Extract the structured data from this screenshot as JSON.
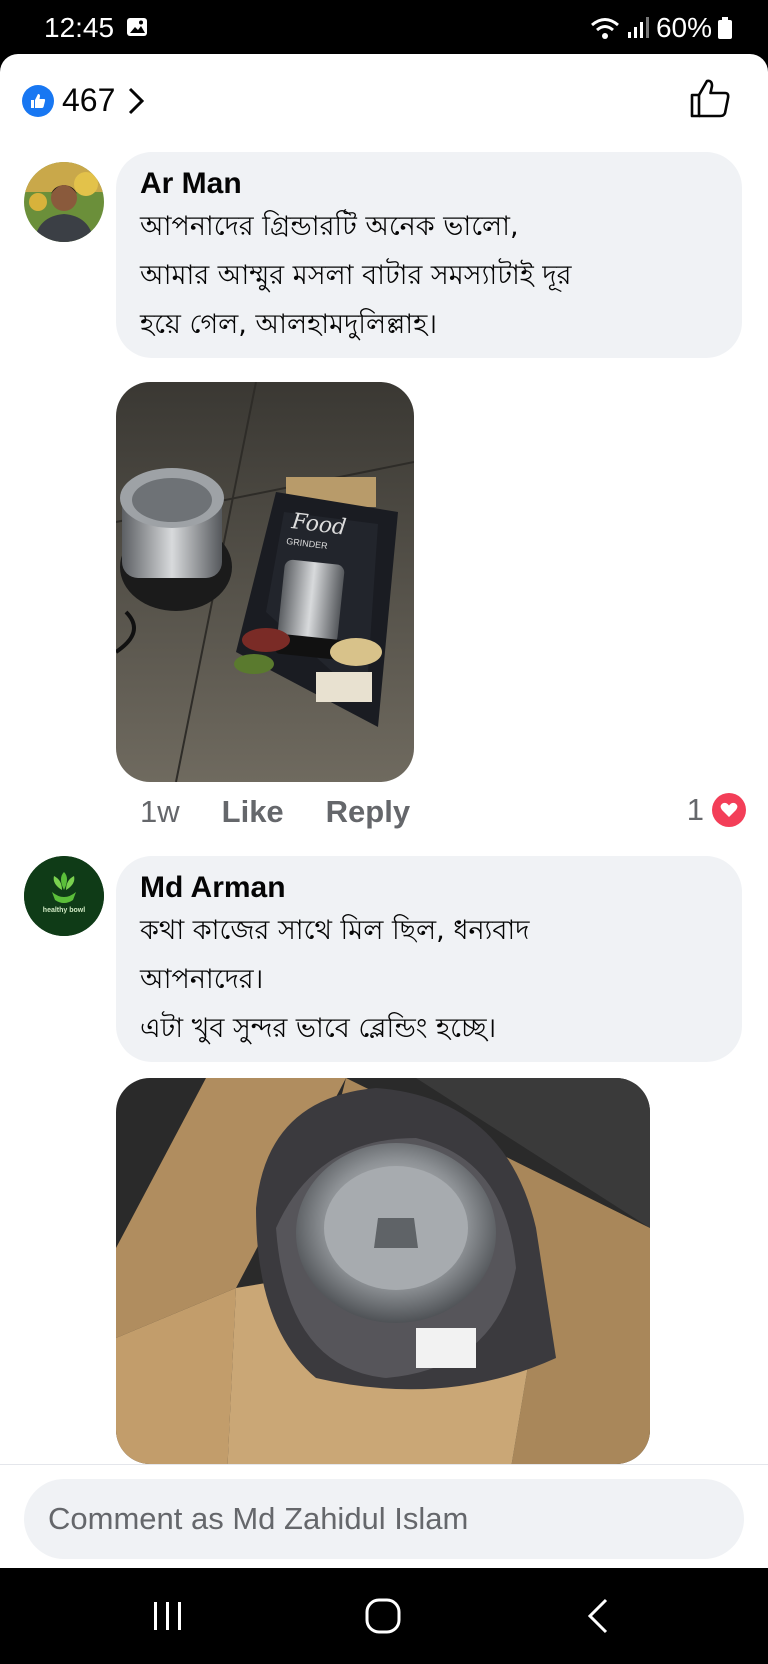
{
  "status_bar": {
    "time": "12:45",
    "battery": "60%"
  },
  "reactions": {
    "count": "467"
  },
  "comments": [
    {
      "author": "Ar Man",
      "text": "আপনাদের গ্রিন্ডারটি অনেক ভালো,\nআমার আম্মুর মসলা বাটার সমস্যাটাই দূর\nহয়ে গেল, আলহামদুলিল্লাহ।",
      "time": "1w",
      "like_label": "Like",
      "reply_label": "Reply",
      "reaction_count": "1",
      "photo": {
        "box_brand": "Food",
        "box_product": "GRINDER"
      }
    },
    {
      "author": "Md Arman",
      "text": "কথা কাজের সাথে মিল ছিল, ধন্যবাদ\nআপনাদের।\nএটা খুব সুন্দর ভাবে ব্লেন্ডিং হচ্ছে।",
      "avatar_label": "healthy bowl"
    }
  ],
  "composer": {
    "placeholder": "Comment as Md Zahidul Islam"
  },
  "colors": {
    "accent": "#1877f2",
    "heart": "#f33e58",
    "bubble": "#f0f2f5"
  }
}
